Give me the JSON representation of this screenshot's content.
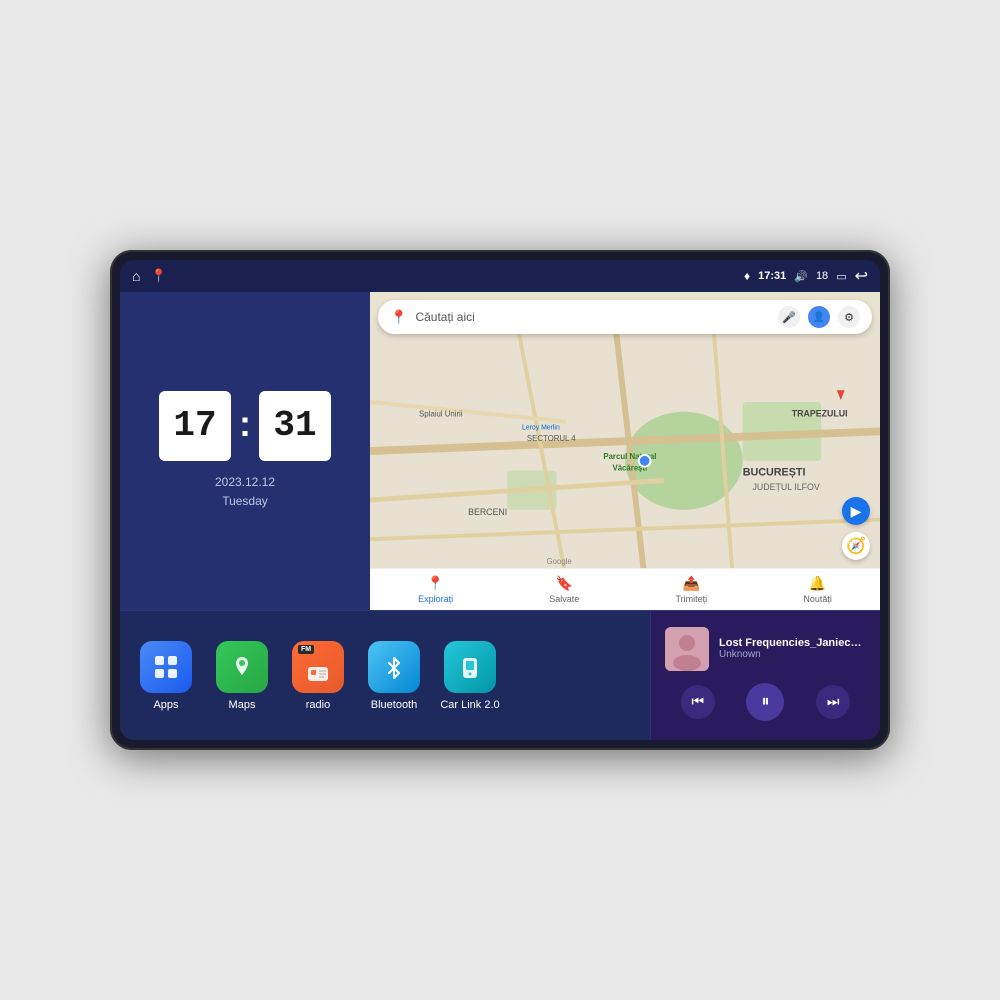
{
  "device": {
    "screen": {
      "status_bar": {
        "left_icons": [
          "home",
          "maps-pin"
        ],
        "time": "17:31",
        "volume_icon": "🔊",
        "battery_level": "18",
        "battery_icon": "🔋",
        "back_icon": "↩"
      },
      "clock_widget": {
        "hours": "17",
        "minutes": "31",
        "date": "2023.12.12",
        "day": "Tuesday"
      },
      "map_widget": {
        "search_placeholder": "Căutați aici",
        "location_label_1": "Parcul Natural Văcărești",
        "location_label_2": "Leroy Merlin",
        "location_label_3": "BUCUREȘTI",
        "location_label_4": "JUDEȚUL ILFOV",
        "location_label_5": "BERCENI",
        "location_label_6": "SECTORUL 4",
        "location_label_7": "TRAPEZULUI",
        "nav_items": [
          {
            "label": "Explorați",
            "icon": "📍",
            "active": true
          },
          {
            "label": "Salvate",
            "icon": "🔖",
            "active": false
          },
          {
            "label": "Trimiteți",
            "icon": "📤",
            "active": false
          },
          {
            "label": "Noutăți",
            "icon": "🔔",
            "active": false
          }
        ]
      },
      "app_icons": [
        {
          "id": "apps",
          "label": "Apps",
          "icon": "⊞",
          "bg_class": "icon-apps"
        },
        {
          "id": "maps",
          "label": "Maps",
          "icon": "🗺",
          "bg_class": "icon-maps"
        },
        {
          "id": "radio",
          "label": "radio",
          "icon": "📻",
          "bg_class": "icon-radio"
        },
        {
          "id": "bluetooth",
          "label": "Bluetooth",
          "icon": "⚡",
          "bg_class": "icon-bluetooth"
        },
        {
          "id": "carlink",
          "label": "Car Link 2.0",
          "icon": "📱",
          "bg_class": "icon-carlink"
        }
      ],
      "music_player": {
        "title": "Lost Frequencies_Janieck Devy-...",
        "artist": "Unknown",
        "prev_icon": "⏮",
        "play_icon": "⏸",
        "next_icon": "⏭"
      }
    }
  }
}
